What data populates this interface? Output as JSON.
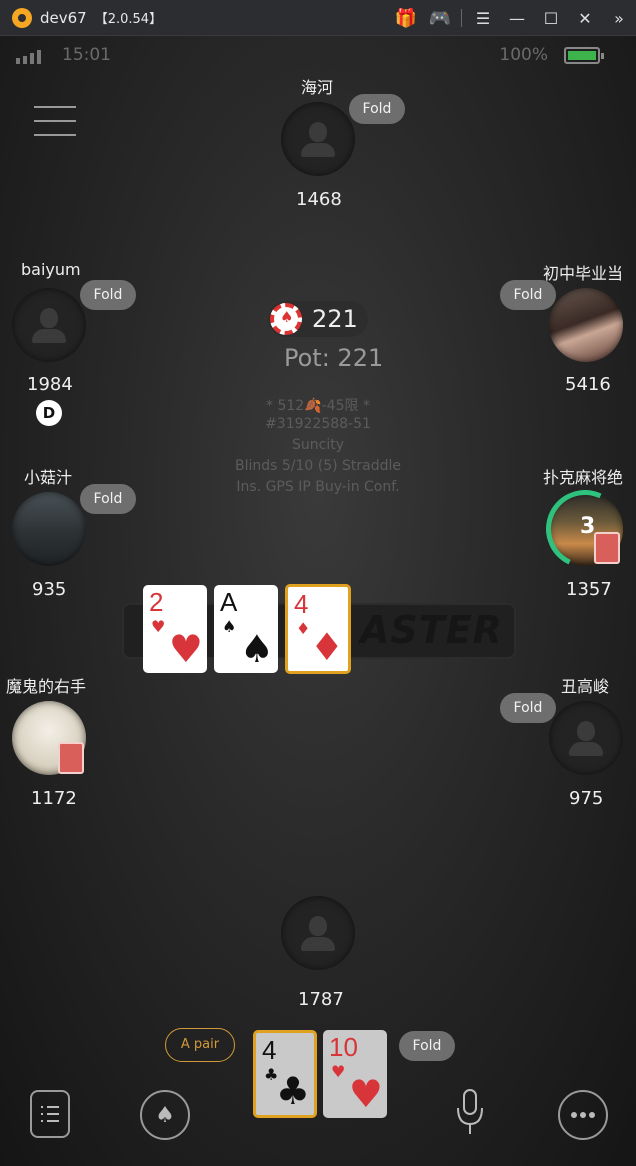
{
  "window": {
    "app_name": "dev67",
    "version": "【2.0.54】"
  },
  "status": {
    "time": "15:01",
    "battery": "100%"
  },
  "pot": {
    "chips": "221",
    "label": "Pot: 221"
  },
  "table_info": [
    "* 512🍂-45限 *",
    "#31922588-51",
    "Suncity",
    "Blinds 5/10 (5) Straddle",
    "Ins. GPS IP Buy-in Conf."
  ],
  "watermark": "ASTER",
  "players": {
    "top": {
      "name": "海河",
      "stack": "1468",
      "status": "Fold"
    },
    "left1": {
      "name": "baiyum",
      "stack": "1984",
      "status": "Fold",
      "dealer": "D"
    },
    "right1": {
      "name": "初中毕业当",
      "stack": "5416",
      "status": "Fold"
    },
    "left2": {
      "name": "小菇汁",
      "stack": "935",
      "status": "Fold"
    },
    "right2": {
      "name": "扑克麻将绝",
      "stack": "1357",
      "timer": "3"
    },
    "left3": {
      "name": "魔鬼的右手",
      "stack": "1172"
    },
    "right3": {
      "name": "丑高峻",
      "stack": "975",
      "status": "Fold"
    },
    "hero": {
      "stack": "1787",
      "status": "Fold",
      "hand_hint": "A pair"
    }
  },
  "board": [
    {
      "rank": "2",
      "suit": "♥",
      "color": "red"
    },
    {
      "rank": "A",
      "suit": "♠",
      "color": "black"
    },
    {
      "rank": "4",
      "suit": "♦",
      "color": "red",
      "highlight": true
    }
  ],
  "hero_cards": [
    {
      "rank": "4",
      "suit": "♣",
      "color": "black",
      "highlight": true
    },
    {
      "rank": "10",
      "suit": "♥",
      "color": "red",
      "dimmed": true
    }
  ],
  "icons": {
    "gift": "gift-icon",
    "gamepad": "gamepad-icon",
    "menu": "menu-icon",
    "minimize": "minimize-icon",
    "maximize": "maximize-icon",
    "close": "close-icon",
    "expand": "chevrons-right-icon"
  },
  "colors": {
    "fold_badge": "#6e6e6e",
    "timer": "#2ec27e",
    "card_red": "#d8353a",
    "highlight": "#e0a020",
    "battery": "#3cb44b"
  }
}
